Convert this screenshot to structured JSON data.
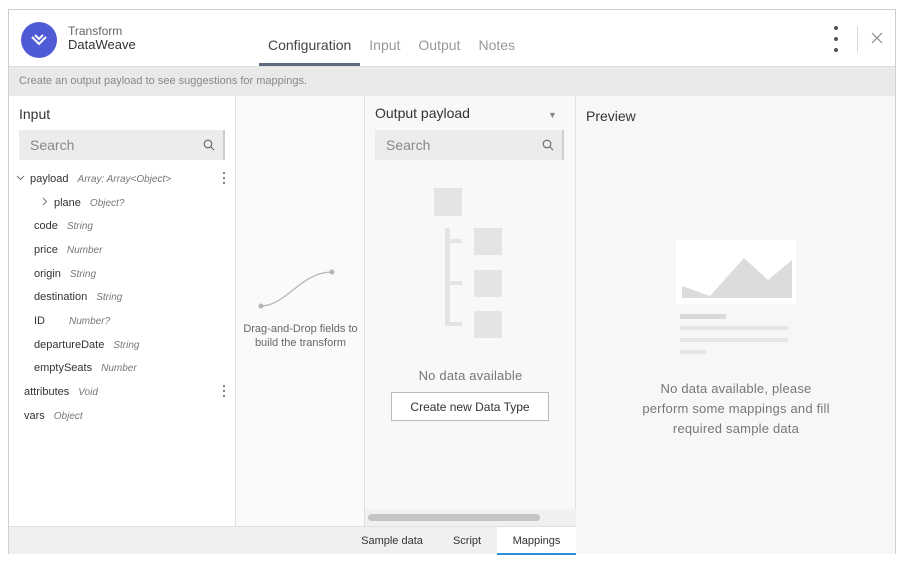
{
  "app": {
    "title_line1": "Transform",
    "title_line2": "DataWeave",
    "brand_color": "#4f5bd5"
  },
  "header": {
    "tabs": [
      {
        "label": "Configuration",
        "active": true
      },
      {
        "label": "Input",
        "active": false
      },
      {
        "label": "Output",
        "active": false
      },
      {
        "label": "Notes",
        "active": false
      }
    ]
  },
  "notice": "Create an output payload to see suggestions for mappings.",
  "input_panel": {
    "title": "Input",
    "search_placeholder": "Search",
    "tree": [
      {
        "name": "payload",
        "type": "Array: Array<Object>"
      },
      {
        "name": "plane",
        "type": "Object?"
      },
      {
        "name": "code",
        "type": "String"
      },
      {
        "name": "price",
        "type": "Number"
      },
      {
        "name": "origin",
        "type": "String"
      },
      {
        "name": "destination",
        "type": "String"
      },
      {
        "name": "ID",
        "type": "Number?"
      },
      {
        "name": "departureDate",
        "type": "String"
      },
      {
        "name": "emptySeats",
        "type": "Number"
      },
      {
        "name": "attributes",
        "type": "Void"
      },
      {
        "name": "vars",
        "type": "Object"
      }
    ]
  },
  "dnd": {
    "line1": "Drag-and-Drop fields to",
    "line2": "build the transform"
  },
  "output_panel": {
    "title": "Output payload",
    "search_placeholder": "Search",
    "no_data": "No data available",
    "create_button": "Create new Data Type"
  },
  "preview_panel": {
    "title": "Preview",
    "line1": "No data available, please",
    "line2": "perform some mappings and fill",
    "line3": "required sample data"
  },
  "bottom_tabs": [
    {
      "label": "Sample data",
      "active": false
    },
    {
      "label": "Script",
      "active": false
    },
    {
      "label": "Mappings",
      "active": true
    }
  ],
  "colors": {
    "active_tab_underline": "#5a6a7a",
    "bottom_tab_accent": "#2e8fd6"
  }
}
